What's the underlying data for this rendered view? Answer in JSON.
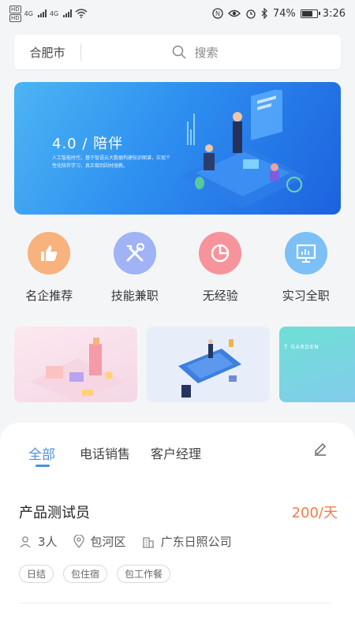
{
  "status_bar": {
    "hd1": "HD",
    "hd2": "HD",
    "net1": "4G",
    "net2": "4G",
    "battery": "74%",
    "time": "3:26",
    "battery_level": 0.74
  },
  "search": {
    "city": "合肥市",
    "placeholder": "搜索"
  },
  "banner": {
    "title": "4.0 / 陪伴",
    "subtitle": "人工智能时代，基于智语云大数据构建知识图谱，实现个性化陪伴学习，真正做到因材施教。"
  },
  "categories": [
    {
      "label": "名企推荐",
      "icon": "thumbs-up-icon",
      "color": "#f7b27d"
    },
    {
      "label": "技能兼职",
      "icon": "tools-icon",
      "color": "#9fb3f5"
    },
    {
      "label": "无经验",
      "icon": "pie-chart-icon",
      "color": "#f7939b"
    },
    {
      "label": "实习全职",
      "icon": "presentation-icon",
      "color": "#7cc0f5"
    }
  ],
  "cards": {
    "garden_text": "T GARDEN"
  },
  "tabs": [
    {
      "label": "全部",
      "active": true
    },
    {
      "label": "电话销售",
      "active": false
    },
    {
      "label": "客户经理",
      "active": false
    }
  ],
  "job": {
    "title": "产品测试员",
    "salary": "200/天",
    "headcount": "3人",
    "location": "包河区",
    "company": "广东日照公司",
    "tags": [
      "日结",
      "包住宿",
      "包工作餐"
    ]
  },
  "colors": {
    "accent": "#4a90e2",
    "salary": "#f07d4a"
  }
}
